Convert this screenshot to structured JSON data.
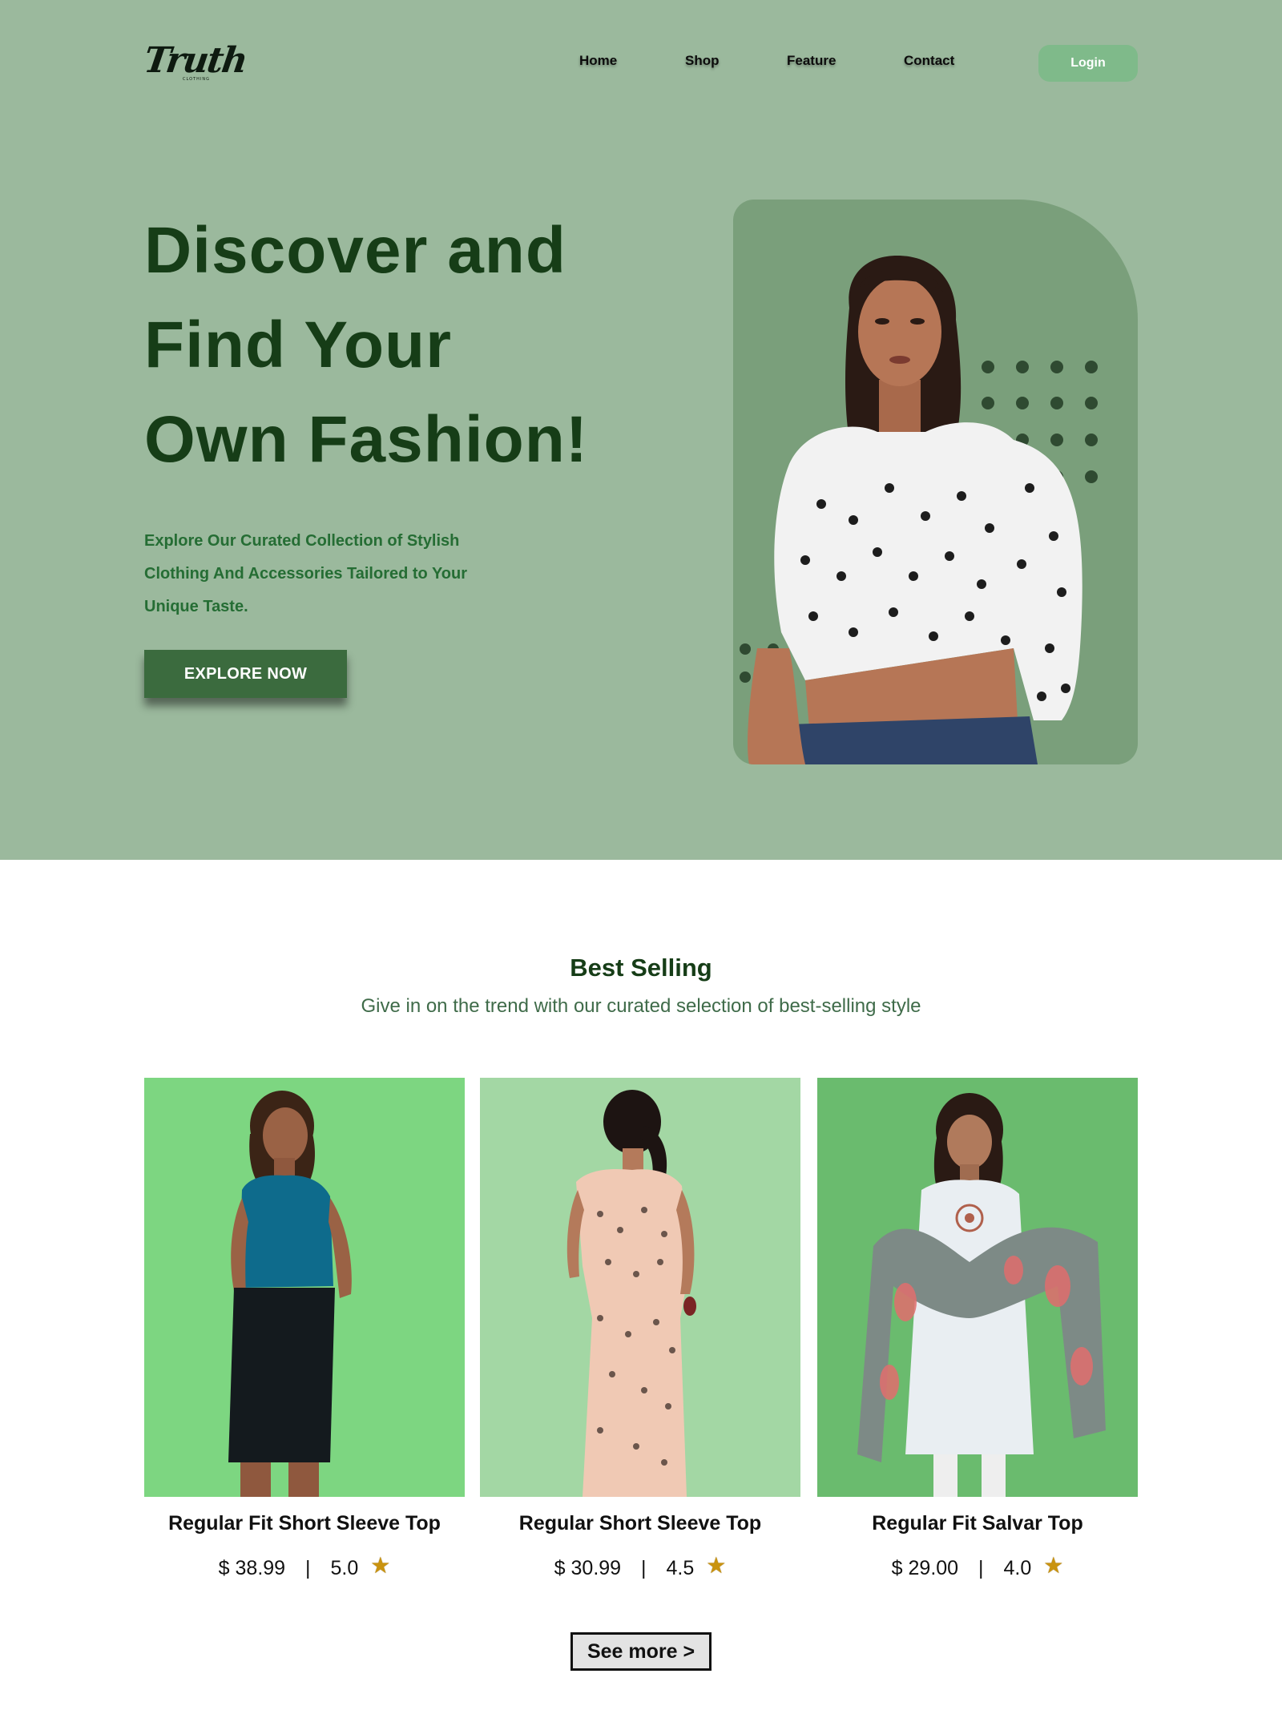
{
  "brand": {
    "name": "Truth",
    "tagline": "CLOTHING"
  },
  "nav": {
    "items": [
      "Home",
      "Shop",
      "Feature",
      "Contact"
    ],
    "login_label": "Login"
  },
  "hero": {
    "title_lines": [
      "Discover and",
      "Find Your",
      "Own Fashion!"
    ],
    "subtitle_lines": [
      "Explore Our Curated Collection of Stylish",
      "Clothing And Accessories Tailored to Your",
      "Unique Taste."
    ],
    "cta_label": "EXPLORE NOW"
  },
  "best_selling": {
    "title": "Best Selling",
    "subtitle": "Give in on the trend with our curated selection of best-selling style",
    "products": [
      {
        "name": "Regular Fit Short Sleeve Top",
        "price": "$ 38.99",
        "separator": "|",
        "rating": "5.0",
        "bg": "#7dd681"
      },
      {
        "name": "Regular Short Sleeve Top",
        "price": "$ 30.99",
        "separator": "|",
        "rating": "4.5",
        "bg": "#a3d7a4"
      },
      {
        "name": "Regular Fit Salvar Top",
        "price": "$ 29.00",
        "separator": "|",
        "rating": "4.0",
        "bg": "#6abb6e"
      }
    ],
    "see_more_label": "See more  >"
  },
  "colors": {
    "hero_bg": "#9bb99d",
    "hero_card": "#7a9f7b",
    "title_green": "#163d17",
    "accent_green": "#3b6b3e",
    "login_bg": "#7fba8a",
    "star": "#c9930f"
  },
  "icons": {
    "rating": "star-icon"
  }
}
